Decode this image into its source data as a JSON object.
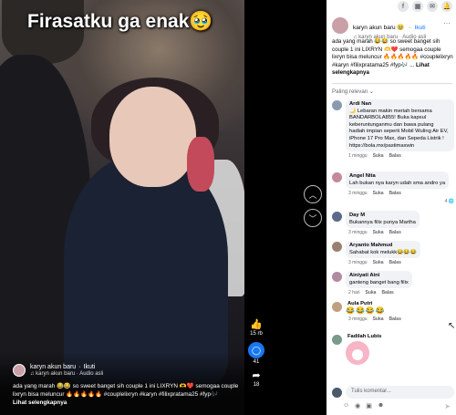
{
  "video": {
    "overlay_text": "Firasatku ga enak🥹",
    "author": "karyn akun baru",
    "follow": "Ikuti",
    "audio": "♫ karyn akun baru · Audio asli",
    "caption": "ada yang marah 😂😂 so sweet banget sih couple 1 ini LIXRYN 🫶❤️ semogaa couple lixryn bisa meluncur 🔥🔥🔥🔥🔥 #couplelixryn #karyn #filixpratama25 #fyp🎶",
    "see_more": "Lihat selengkapnya"
  },
  "rail": {
    "up_icon": "chevron-up-icon",
    "down_icon": "chevron-down-icon",
    "likes": "15 rb",
    "comments": "41",
    "shares": "18"
  },
  "topbar": {
    "icons": [
      "facebook-icon",
      "grid-icon",
      "messenger-icon",
      "bell-icon"
    ]
  },
  "post": {
    "author": "karyn akun baru 🥹",
    "dot": "·",
    "follow": "Ikuti",
    "audio": "♫ karyn akun baru · Audio asli",
    "caption": "ada yang marah 😂😂 so sweet banget sih couple 1 ini LIXRYN 🫶❤️ semogaa couple lixryn bisa meluncur 🔥🔥🔥🔥🔥 #couplelixryn #karyn #filixpratama25 #fyp🎶 ...",
    "see_more": "Lihat selengkapnya"
  },
  "sort_label": "Paling relevan ⌄",
  "comments": [
    {
      "name": "Ardi Nan",
      "text": "🌙 Lebaran makin meriah bersama BANDARBOLA855! Buka kapsul keberuntunganmu dan bawa pulang hadiah impian seperti Mobil Wuling Air EV, iPhone 17 Pro Max, dan Sepeda Listrik ! https://bola.mx/pastimaxwin",
      "time": "1 minggu",
      "like": "Suka",
      "reply": "Balas",
      "reactions": "",
      "color": "#8a9bb0"
    },
    {
      "name": "Angel Nita",
      "text": "Lah bukan nya karyn udah sma andro ya",
      "time": "3 minggu",
      "like": "Suka",
      "reply": "Balas",
      "reactions": "4 🌐",
      "color": "#c58a9a"
    },
    {
      "name": "Day M",
      "text": "Bukannya filix punya Martha",
      "time": "3 minggu",
      "like": "Suka",
      "reply": "Balas",
      "reactions": "",
      "color": "#5a6a8a"
    },
    {
      "name": "Aryanto Mahmud",
      "text": "Sahabat kok melukk😂😂😂",
      "time": "3 minggu",
      "like": "Suka",
      "reply": "Balas",
      "reactions": "",
      "color": "#9a8070"
    },
    {
      "name": "Ainiyati Aini",
      "text": "ganteng banget bang filix",
      "time": "2 hari",
      "like": "Suka",
      "reply": "Balas",
      "reactions": "",
      "color": "#b08aa0"
    },
    {
      "name": "Aula Putri",
      "text": "😂😂😂😂",
      "time": "3 minggu",
      "like": "Suka",
      "reply": "Balas",
      "reactions": "",
      "color": "#c0a080"
    },
    {
      "name": "Fadilah Lubis",
      "text": "",
      "time": "",
      "like": "",
      "reply": "",
      "reactions": "",
      "color": "#7a9a8a"
    }
  ],
  "composer": {
    "placeholder": "Tulis komentar...",
    "tools": [
      "sticker-icon",
      "camera-icon",
      "gif-icon",
      "emoji-icon"
    ],
    "send_icon": "send-icon"
  }
}
